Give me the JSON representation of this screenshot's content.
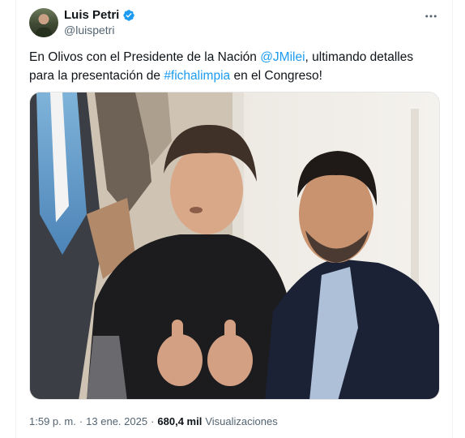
{
  "author": {
    "name": "Luis Petri",
    "handle": "@luispetri",
    "verified_color": "#1d9bf0"
  },
  "menu": {
    "more_label": "•••"
  },
  "tweet": {
    "text_part1": "En Olivos con el Presidente de la Nación ",
    "mention": "@JMilei",
    "text_part2": ", ultimando detalles para la presentación de ",
    "hashtag": "#fichalimpia",
    "text_part3": " en el Congreso!"
  },
  "media": {
    "alt_icon": "photo"
  },
  "meta": {
    "time": "1:59 p. m.",
    "separator": "·",
    "date": "13 ene. 2025",
    "views_count": "680,4 mil",
    "views_label": "Visualizaciones"
  },
  "colors": {
    "link": "#1d9bf0",
    "secondary_text": "#536471",
    "primary_text": "#0f1419"
  }
}
